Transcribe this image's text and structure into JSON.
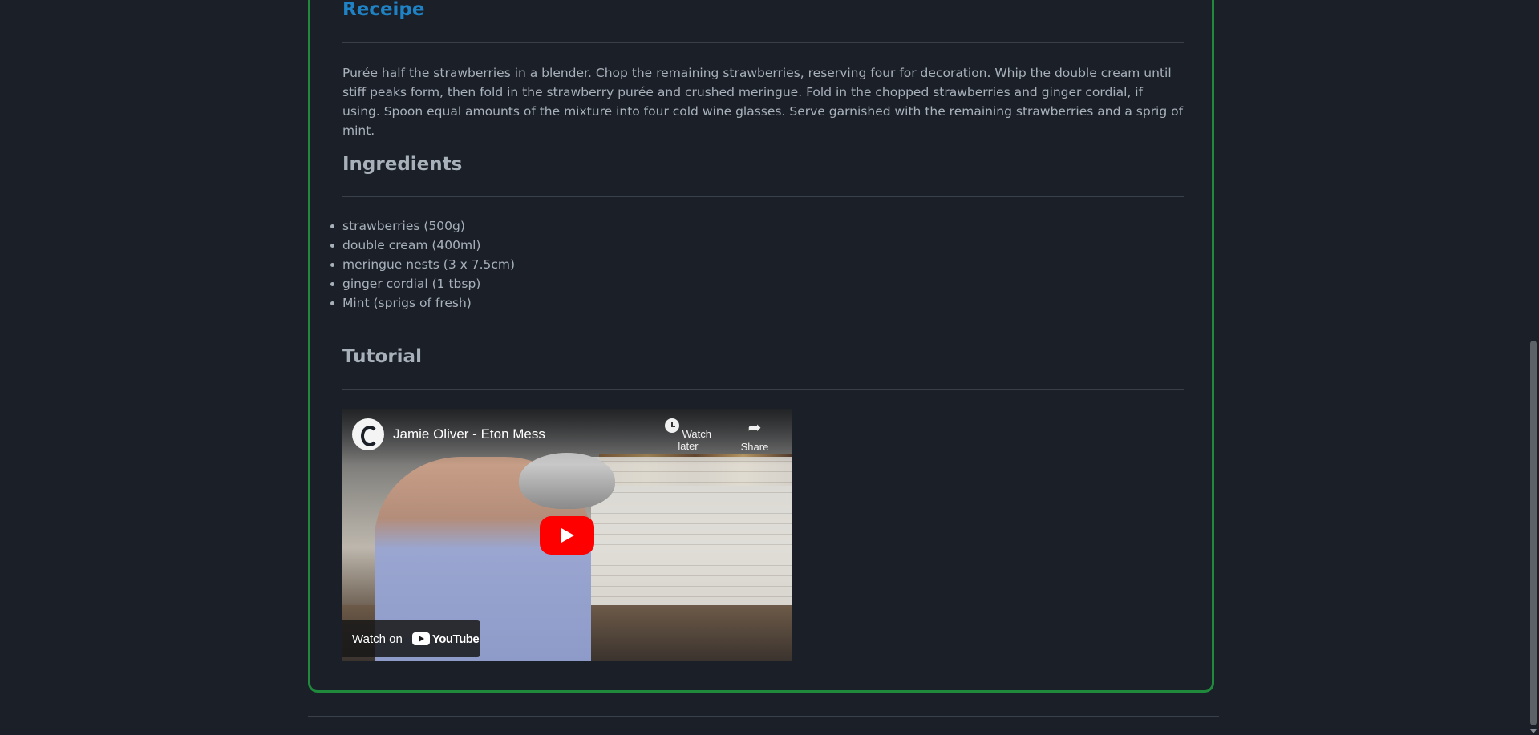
{
  "receipe": {
    "title": "Receipe",
    "instructions": "Purée half the strawberries in a blender. Chop the remaining strawberries, reserving four for decoration. Whip the double cream until stiff peaks form, then fold in the strawberry purée and crushed meringue. Fold in the chopped strawberries and ginger cordial, if using. Spoon equal amounts of the mixture into four cold wine glasses. Serve garnished with the remaining strawberries and a sprig of mint."
  },
  "ingredients": {
    "title": "Ingredients",
    "items": [
      "strawberries (500g)",
      "double cream (400ml)",
      "meringue nests (3 x 7.5cm)",
      "ginger cordial (1 tbsp)",
      "Mint (sprigs of fresh)"
    ]
  },
  "tutorial": {
    "title": "Tutorial",
    "video": {
      "title": "Jamie Oliver - Eton Mess",
      "watch_later_label": "Watch later",
      "share_label": "Share",
      "watch_on_label": "Watch on",
      "youtube_label": "YouTube",
      "play_icon": "play-icon"
    }
  },
  "colors": {
    "background": "#1b2028",
    "accent_title": "#1f82c4",
    "card_border": "#1f8a3c",
    "text": "#a8b0ba",
    "youtube_red": "#ff0000"
  }
}
